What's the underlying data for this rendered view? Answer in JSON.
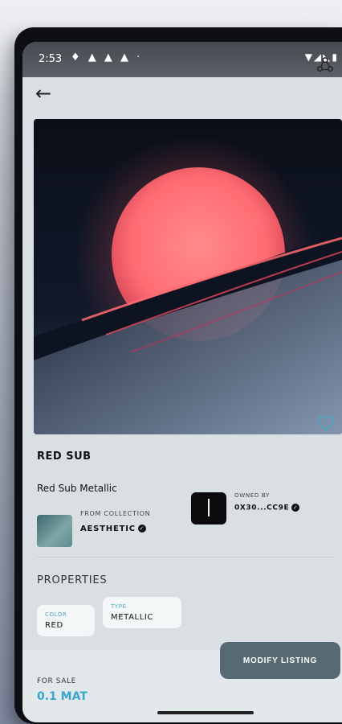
{
  "status": {
    "time": "2:53",
    "notif_icons": "♦ ▲ ▲ ▲ ·",
    "right_icons": "▼◢◣▮"
  },
  "nft": {
    "title": "RED SUB",
    "subtitle": "Red Sub Metallic"
  },
  "collection": {
    "label": "FROM COLLECTION",
    "name": "AESTHETIC"
  },
  "owner": {
    "label": "OWNED BY",
    "name": "0X30...CC9E"
  },
  "properties": {
    "title": "PROPERTIES",
    "items": [
      {
        "label": "COLOR",
        "value": "RED"
      },
      {
        "label": "TYPE",
        "value": "METALLIC"
      }
    ]
  },
  "footer": {
    "for_sale_label": "FOR SALE",
    "price": "0.1 MAT",
    "modify_button": "MODIFY LISTING"
  },
  "colors": {
    "accent": "#3aa6cf",
    "button": "#566a73",
    "screen_bg": "#d9dfe2"
  },
  "icons": [
    "back-arrow-icon",
    "share-icon",
    "heart-icon",
    "verified-badge-icon"
  ]
}
